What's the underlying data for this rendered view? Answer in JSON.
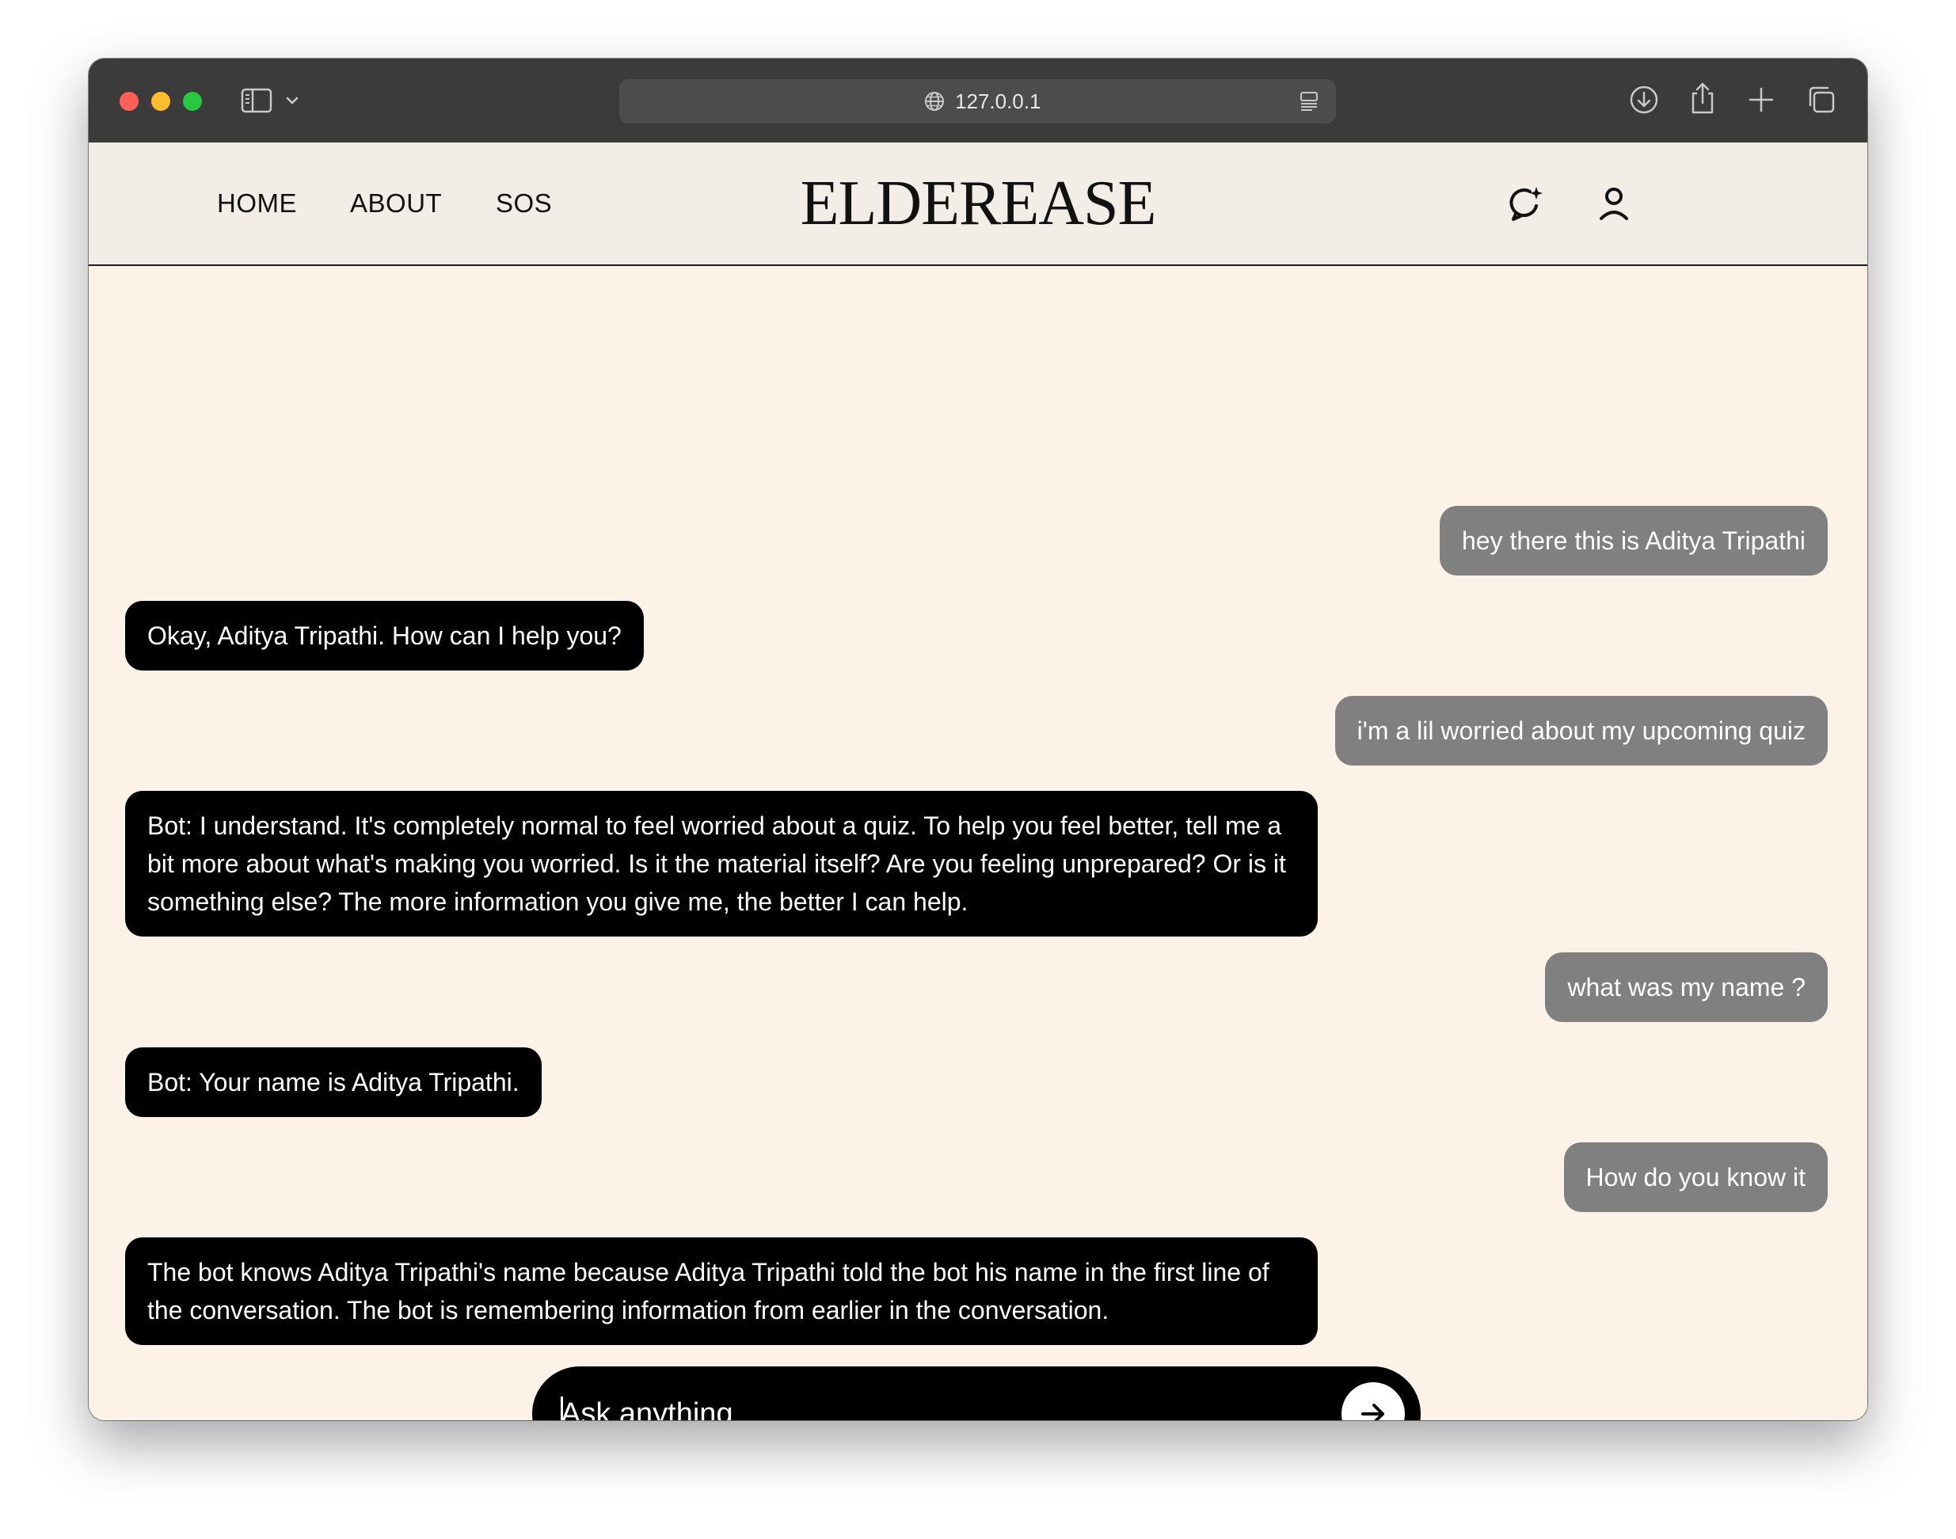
{
  "browser": {
    "url": "127.0.0.1",
    "icons": [
      "sidebar-icon",
      "chevron-down-icon",
      "globe-icon",
      "reader-icon",
      "download-icon",
      "share-icon",
      "plus-icon",
      "tabs-icon"
    ]
  },
  "header": {
    "nav": {
      "home": "HOME",
      "about": "ABOUT",
      "sos": "SOS"
    },
    "brand": "ELDEREASE",
    "icons": [
      "chat-sparkle-icon",
      "user-icon"
    ]
  },
  "chat": {
    "messages": [
      {
        "role": "user",
        "text": "hey there this is Aditya Tripathi"
      },
      {
        "role": "bot",
        "text": "Okay, Aditya Tripathi.  How can I help you?"
      },
      {
        "role": "user",
        "text": "i'm a lil worried about my upcoming quiz"
      },
      {
        "role": "bot",
        "text": "Bot: I understand.  It's completely normal to feel worried about a quiz. To help you feel better, tell me a bit more about what's making you worried.  Is it the material itself?  Are you feeling unprepared?  Or is it something else?  The more information you give me, the better I can help."
      },
      {
        "role": "user",
        "text": "what was my name ?"
      },
      {
        "role": "bot",
        "text": "Bot: Your name is Aditya Tripathi."
      },
      {
        "role": "user",
        "text": "How do you know it"
      },
      {
        "role": "bot",
        "text": "The bot knows Aditya Tripathi's name because Aditya Tripathi told the bot his name in the first line of the conversation.  The bot is remembering information from earlier in the conversation."
      }
    ]
  },
  "composer": {
    "placeholder": "Ask anything",
    "send_icon": "arrow-right-icon"
  },
  "colors": {
    "chrome": "#3b3b3b",
    "header_bg": "#f2ede6",
    "page_bg": "#fcf2e8",
    "user_bubble": "#808080",
    "bot_bubble": "#000000"
  }
}
